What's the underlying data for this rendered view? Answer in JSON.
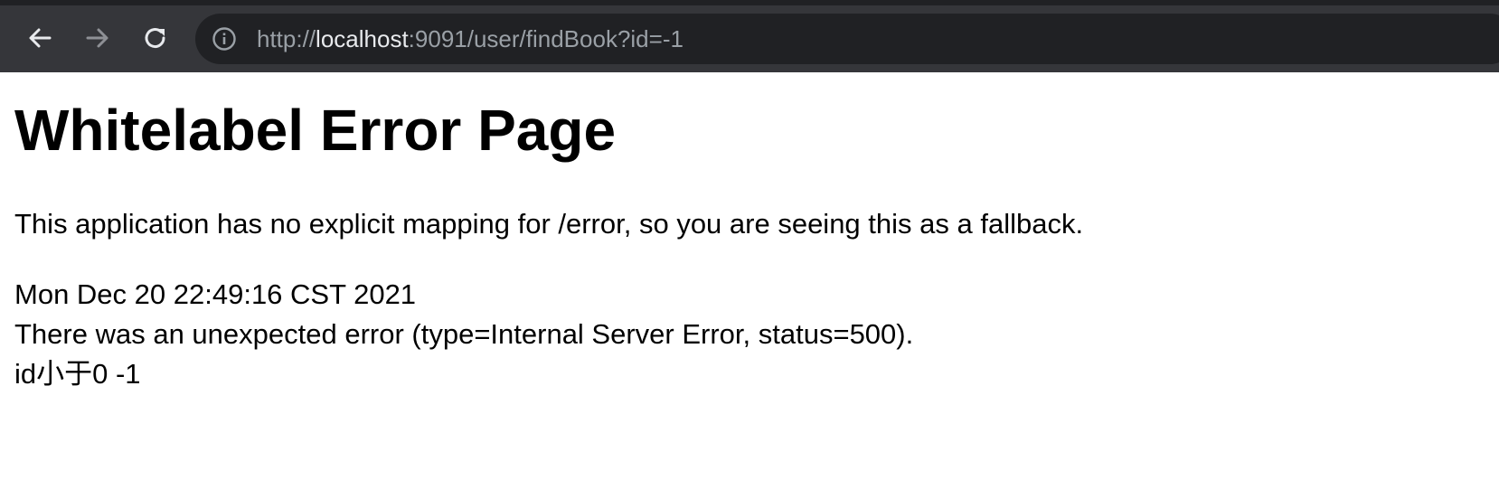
{
  "browser": {
    "url_scheme": "http://",
    "url_host": "localhost",
    "url_rest": ":9091/user/findBook?id=-1",
    "icons": {
      "back": "arrow-left-icon",
      "forward": "arrow-right-icon",
      "reload": "reload-icon",
      "site_info": "info-icon"
    }
  },
  "page": {
    "title": "Whitelabel Error Page",
    "description": "This application has no explicit mapping for /error, so you are seeing this as a fallback.",
    "timestamp": "Mon Dec 20 22:49:16 CST 2021",
    "error_line": "There was an unexpected error (type=Internal Server Error, status=500).",
    "message": "id小于0 -1"
  }
}
